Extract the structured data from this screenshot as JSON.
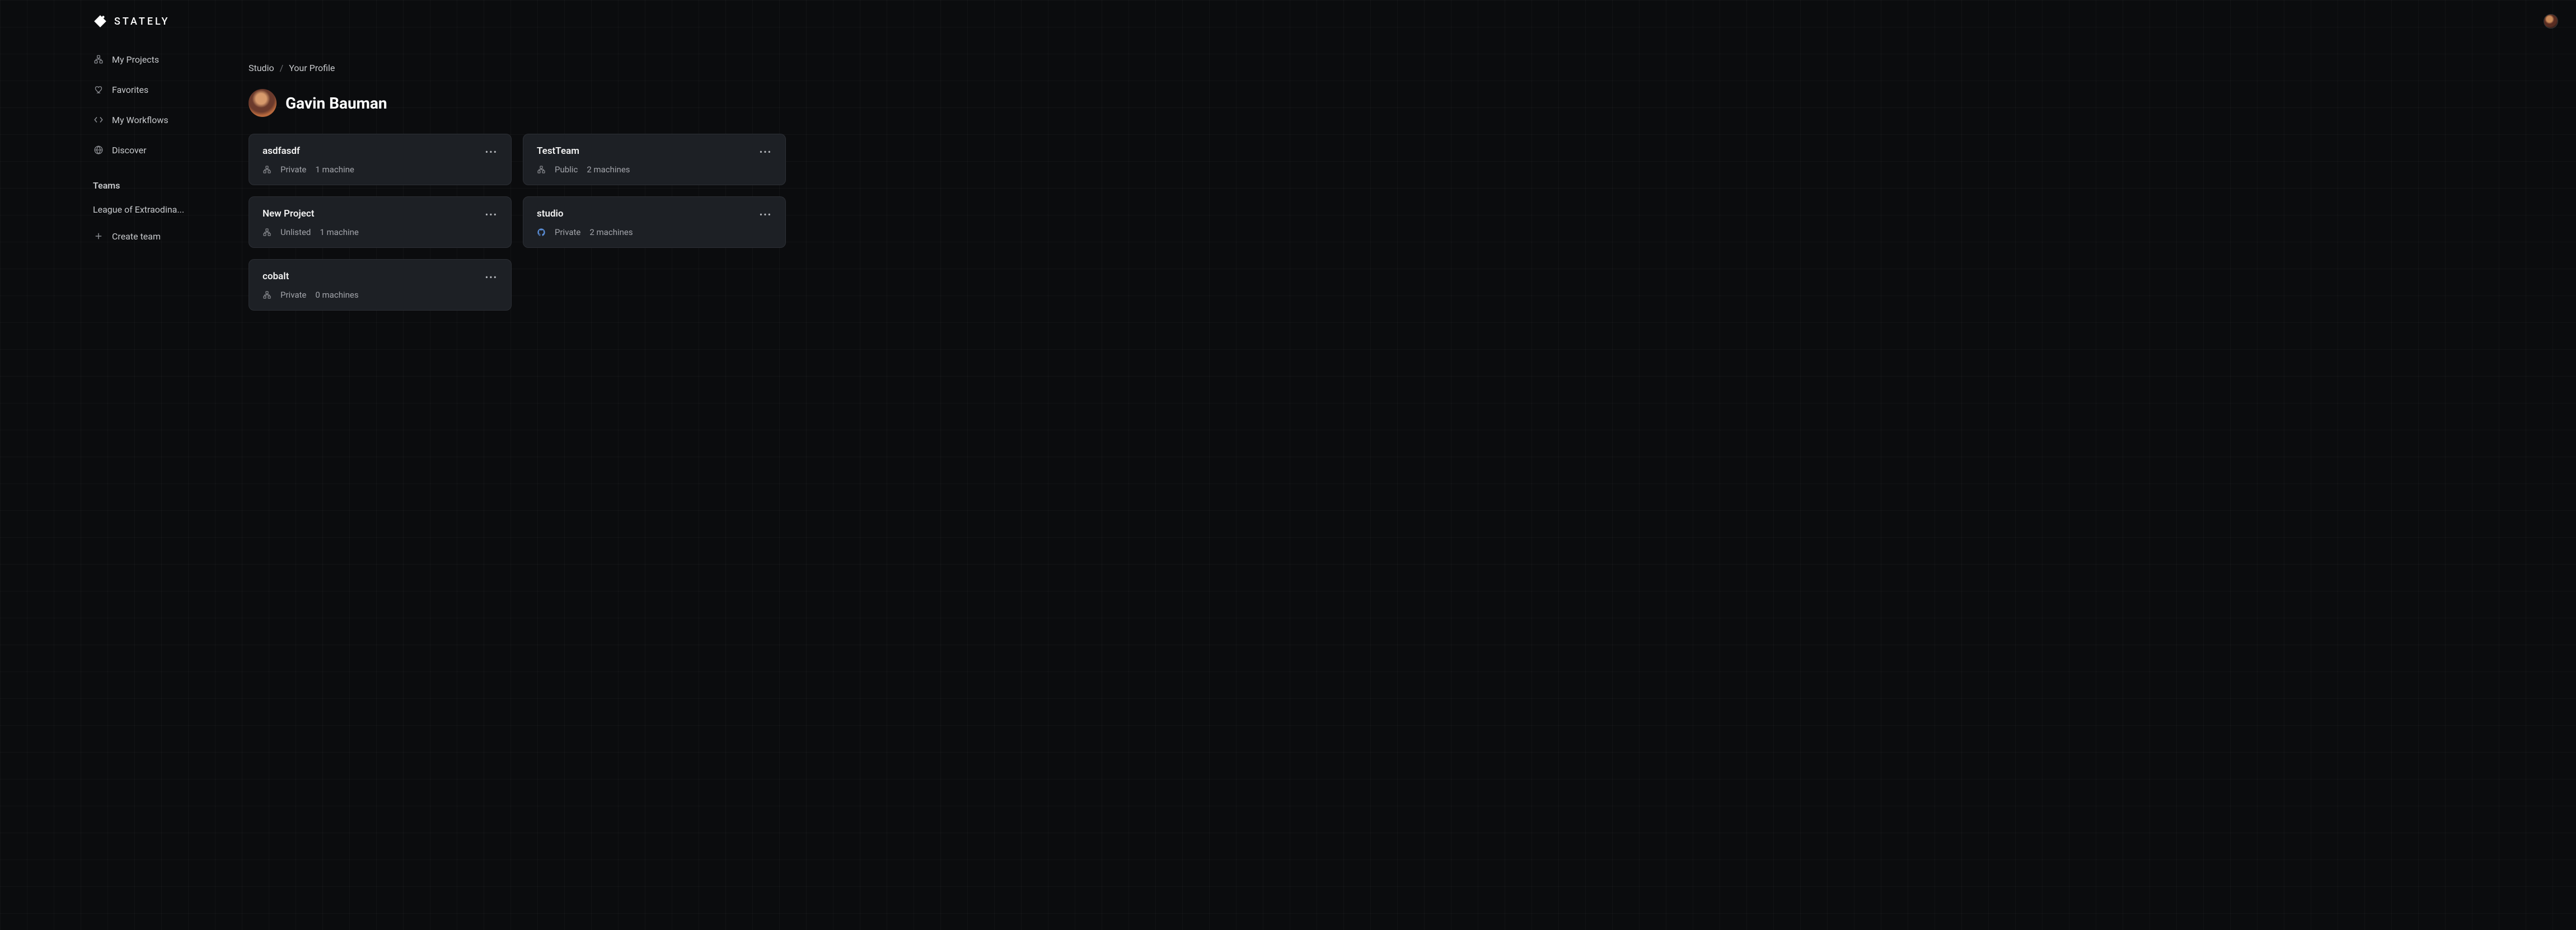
{
  "brand": {
    "name": "STATELY"
  },
  "sidebar": {
    "nav": [
      {
        "label": "My Projects"
      },
      {
        "label": "Favorites"
      },
      {
        "label": "My Workflows"
      },
      {
        "label": "Discover"
      }
    ],
    "teams_header": "Teams",
    "teams": [
      {
        "label": "League of Extraodina..."
      }
    ],
    "create_team_label": "Create team"
  },
  "breadcrumbs": {
    "root": "Studio",
    "sep": "/",
    "current": "Your Profile"
  },
  "profile": {
    "name": "Gavin Bauman"
  },
  "projects": [
    {
      "name": "asdfasdf",
      "visibility": "Private",
      "machines": "1 machine",
      "source": "stately"
    },
    {
      "name": "TestTeam",
      "visibility": "Public",
      "machines": "2 machines",
      "source": "stately"
    },
    {
      "name": "New Project",
      "visibility": "Unlisted",
      "machines": "1 machine",
      "source": "stately"
    },
    {
      "name": "studio",
      "visibility": "Private",
      "machines": "2 machines",
      "source": "github"
    },
    {
      "name": "cobalt",
      "visibility": "Private",
      "machines": "0 machines",
      "source": "stately"
    }
  ]
}
